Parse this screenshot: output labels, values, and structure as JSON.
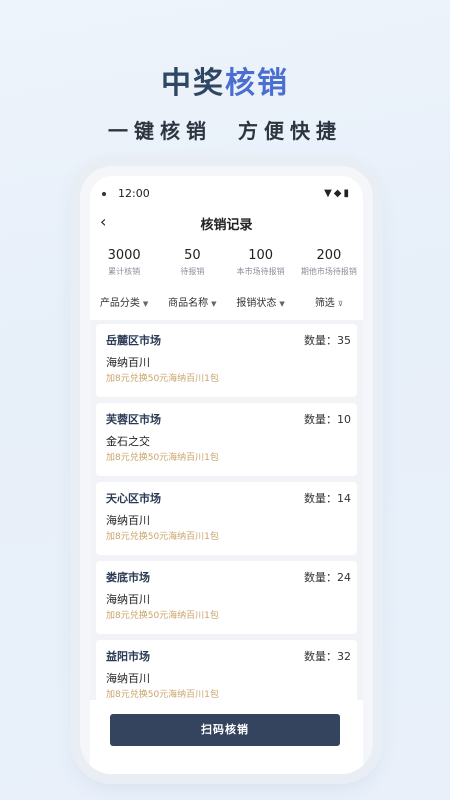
{
  "hero": {
    "title_main": "中奖",
    "title_accent": "核销",
    "subtitle": "一键核销　方便快捷"
  },
  "statusbar": {
    "time": "12:00",
    "icons": "▼◆▮"
  },
  "navbar": {
    "back": "‹",
    "title": "核销记录"
  },
  "stats": [
    {
      "value": "3000",
      "label": "累计核销"
    },
    {
      "value": "50",
      "label": "待报销"
    },
    {
      "value": "100",
      "label": "本市场待报销"
    },
    {
      "value": "200",
      "label": "期他市场待报销"
    }
  ],
  "filters": [
    {
      "label": "产品分类",
      "icon": "▼"
    },
    {
      "label": "商品名称",
      "icon": "▼"
    },
    {
      "label": "报销状态",
      "icon": "▼"
    },
    {
      "label": "筛选",
      "icon": "⊽"
    }
  ],
  "records": [
    {
      "market": "岳麓区市场",
      "qty": "数量：35",
      "product": "海纳百川",
      "promo": "加8元兑换50元海纳百川1包"
    },
    {
      "market": "芙蓉区市场",
      "qty": "数量：10",
      "product": "金石之交",
      "promo": "加8元兑换50元海纳百川1包"
    },
    {
      "market": "天心区市场",
      "qty": "数量：14",
      "product": "海纳百川",
      "promo": "加8元兑换50元海纳百川1包"
    },
    {
      "market": "娄底市场",
      "qty": "数量：24",
      "product": "海纳百川",
      "promo": "加8元兑换50元海纳百川1包"
    },
    {
      "market": "益阳市场",
      "qty": "数量：32",
      "product": "海纳百川",
      "promo": "加8元兑换50元海纳百川1包"
    }
  ],
  "action": {
    "scan_label": "扫码核销"
  },
  "colors": {
    "title": "#2f4664",
    "accent": "#4a6fd1",
    "button": "#34435e",
    "promo": "#c8a46a"
  }
}
